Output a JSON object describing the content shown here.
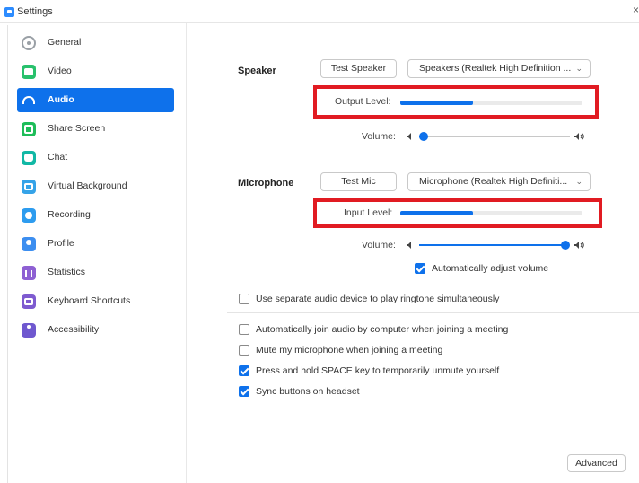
{
  "window": {
    "title": "Settings",
    "close_glyph": "×"
  },
  "sidebar": {
    "items": [
      {
        "label": "General",
        "icon": "general-icon"
      },
      {
        "label": "Video",
        "icon": "video-icon"
      },
      {
        "label": "Audio",
        "icon": "headphones-icon",
        "active": true
      },
      {
        "label": "Share Screen",
        "icon": "share-screen-icon"
      },
      {
        "label": "Chat",
        "icon": "chat-icon"
      },
      {
        "label": "Virtual Background",
        "icon": "virtual-background-icon"
      },
      {
        "label": "Recording",
        "icon": "recording-icon"
      },
      {
        "label": "Profile",
        "icon": "profile-icon"
      },
      {
        "label": "Statistics",
        "icon": "statistics-icon"
      },
      {
        "label": "Keyboard Shortcuts",
        "icon": "keyboard-icon"
      },
      {
        "label": "Accessibility",
        "icon": "accessibility-icon"
      }
    ]
  },
  "speaker": {
    "section_label": "Speaker",
    "test_button": "Test Speaker",
    "device": "Speakers (Realtek High Definition ...",
    "output_label": "Output Level:",
    "output_level": 0.4,
    "volume_label": "Volume:",
    "volume_level": 0.03
  },
  "microphone": {
    "section_label": "Microphone",
    "test_button": "Test Mic",
    "device": "Microphone (Realtek High Definiti...",
    "input_label": "Input Level:",
    "input_level": 0.4,
    "volume_label": "Volume:",
    "volume_level": 0.97,
    "auto_adjust_label": "Automatically adjust volume",
    "auto_adjust_checked": true
  },
  "options": {
    "separate_device": {
      "label": "Use separate audio device to play ringtone simultaneously",
      "checked": false
    },
    "auto_join": {
      "label": "Automatically join audio by computer when joining a meeting",
      "checked": false
    },
    "mute_on_join": {
      "label": "Mute my microphone when joining a meeting",
      "checked": false
    },
    "space_unmute": {
      "label": "Press and hold SPACE key to temporarily unmute yourself",
      "checked": true
    },
    "sync_headset": {
      "label": "Sync buttons on headset",
      "checked": true
    }
  },
  "advanced_button": "Advanced",
  "colors": {
    "accent": "#0e71eb",
    "highlight": "#e11b22"
  }
}
